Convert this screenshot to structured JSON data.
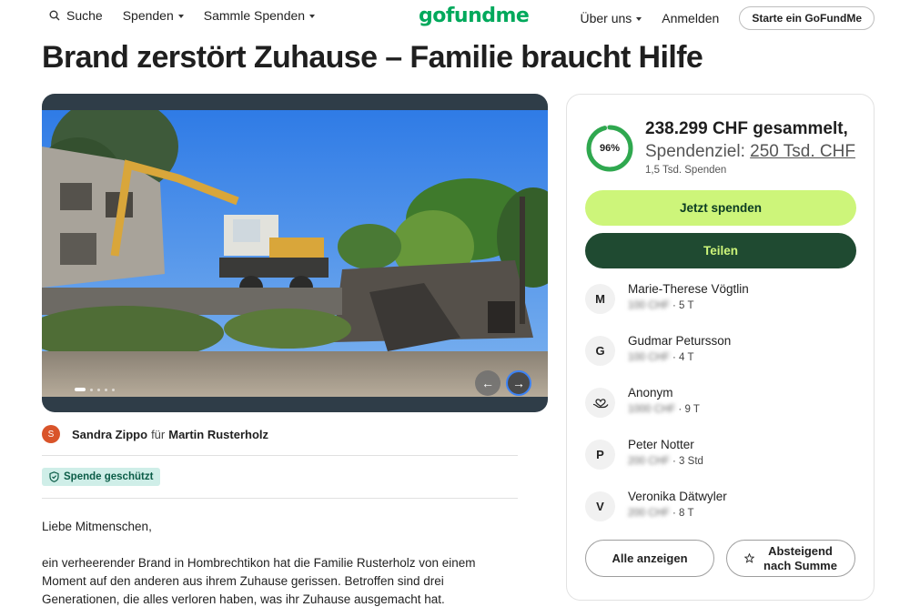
{
  "nav": {
    "search_label": "Suche",
    "donate_menu": "Spenden",
    "collect_menu": "Sammle Spenden",
    "logo_text": "gofundme",
    "about_menu": "Über uns",
    "login_label": "Anmelden",
    "start_button": "Starte ein GoFundMe"
  },
  "campaign": {
    "title": "Brand zerstört Zuhause – Familie braucht Hilfe",
    "organizer_initial": "S",
    "organizer_name": "Sandra Zippo",
    "for_word": "für",
    "beneficiary_name": "Martin Rusterholz",
    "protected_badge": "Spende geschützt",
    "story": [
      "Liebe Mitmenschen,",
      "ein verheerender Brand in Hombrechtikon hat die Familie Rusterholz von einem Moment auf den anderen aus ihrem Zuhause gerissen. Betroffen sind drei Generationen, die alles verloren haben, was ihr Zuhause ausgemacht hat."
    ]
  },
  "gallery": {
    "prev_symbol": "←",
    "next_symbol": "→",
    "active_index": 0
  },
  "card": {
    "progress_label": "96%",
    "progress_fraction": 0.96,
    "raised_text": "238.299 CHF gesammelt,",
    "goal_prefix": "Spendenziel:",
    "goal_amount": "250 Tsd. CHF",
    "donation_count": "1,5 Tsd. Spenden",
    "donate_button": "Jetzt spenden",
    "share_button": "Teilen",
    "donors": [
      {
        "initial": "M",
        "name": "Marie-Therese Vögtlin",
        "amount": "100 CHF",
        "time": "· 5 T"
      },
      {
        "initial": "G",
        "name": "Gudmar Petursson",
        "amount": "100 CHF",
        "time": "· 4 T"
      },
      {
        "initial": "",
        "icon": "heart-hand-icon",
        "name": "Anonym",
        "amount": "1000 CHF",
        "time": "· 9 T"
      },
      {
        "initial": "P",
        "name": "Peter Notter",
        "amount": "200 CHF",
        "time": "· 3 Std"
      },
      {
        "initial": "V",
        "name": "Veronika Dätwyler",
        "amount": "200 CHF",
        "time": "· 8 T"
      }
    ],
    "show_all_button": "Alle anzeigen",
    "sort_button_line1": "Absteigend",
    "sort_button_line2": "nach Summe"
  },
  "colors": {
    "brand_green": "#02a95c",
    "donate_button_bg": "#cdf57a",
    "share_button_bg": "#1f4a31",
    "progress_green": "#2fa84f"
  }
}
